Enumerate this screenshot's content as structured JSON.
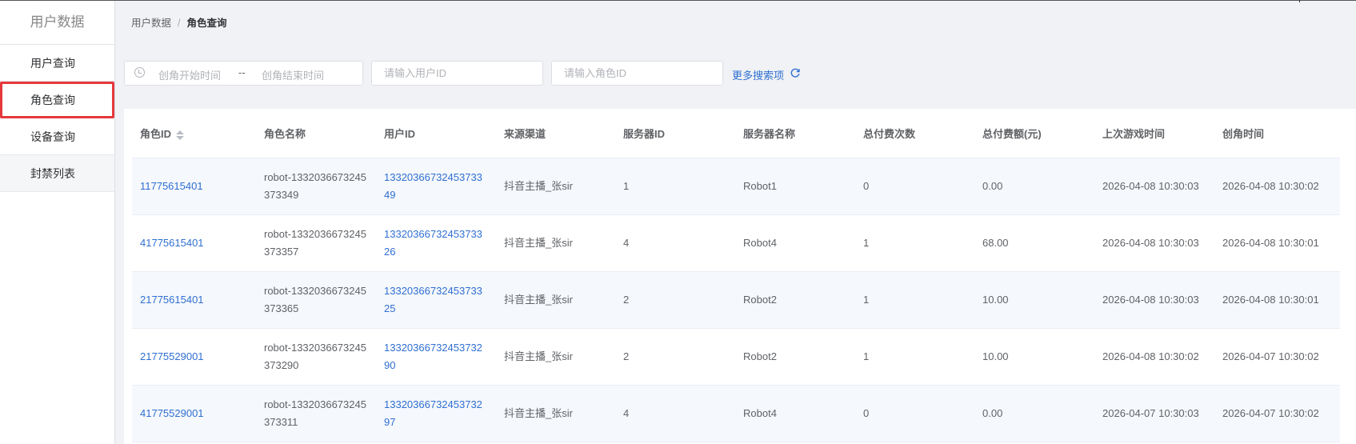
{
  "sidebar": {
    "title": "用户数据",
    "items": [
      {
        "label": "用户查询"
      },
      {
        "label": "角色查询"
      },
      {
        "label": "设备查询"
      },
      {
        "label": "封禁列表"
      }
    ]
  },
  "breadcrumb": {
    "root": "用户数据",
    "separator": "/",
    "current": "角色查询"
  },
  "filters": {
    "start_placeholder": "创角开始时间",
    "range_separator": "--",
    "end_placeholder": "创角结束时间",
    "user_id_placeholder": "请输入用户ID",
    "role_id_placeholder": "请输入角色ID",
    "more_label": "更多搜索项"
  },
  "table": {
    "headers": [
      "角色ID",
      "角色名称",
      "用户ID",
      "来源渠道",
      "服务器ID",
      "服务器名称",
      "总付费次数",
      "总付费额(元)",
      "上次游戏时间",
      "创角时间"
    ],
    "rows": [
      [
        "11775615401",
        "robot-1332036673245373349",
        "1332036673245373349",
        "抖音主播_张sir",
        "1",
        "Robot1",
        "0",
        "0.00",
        "2026-04-08 10:30:03",
        "2026-04-08 10:30:02"
      ],
      [
        "41775615401",
        "robot-1332036673245373357",
        "1332036673245373326",
        "抖音主播_张sir",
        "4",
        "Robot4",
        "1",
        "68.00",
        "2026-04-08 10:30:03",
        "2026-04-08 10:30:01"
      ],
      [
        "21775615401",
        "robot-1332036673245373365",
        "1332036673245373325",
        "抖音主播_张sir",
        "2",
        "Robot2",
        "1",
        "10.00",
        "2026-04-08 10:30:03",
        "2026-04-08 10:30:01"
      ],
      [
        "21775529001",
        "robot-1332036673245373290",
        "1332036673245373290",
        "抖音主播_张sir",
        "2",
        "Robot2",
        "1",
        "10.00",
        "2026-04-08 10:30:02",
        "2026-04-07 10:30:02"
      ],
      [
        "41775529001",
        "robot-1332036673245373311",
        "1332036673245373297",
        "抖音主播_张sir",
        "4",
        "Robot4",
        "0",
        "0.00",
        "2026-04-07 10:30:03",
        "2026-04-07 10:30:02"
      ]
    ]
  },
  "colors": {
    "link": "#2f6fd1",
    "active_outline": "#e5383b",
    "stripe": "#f5f8fc"
  }
}
